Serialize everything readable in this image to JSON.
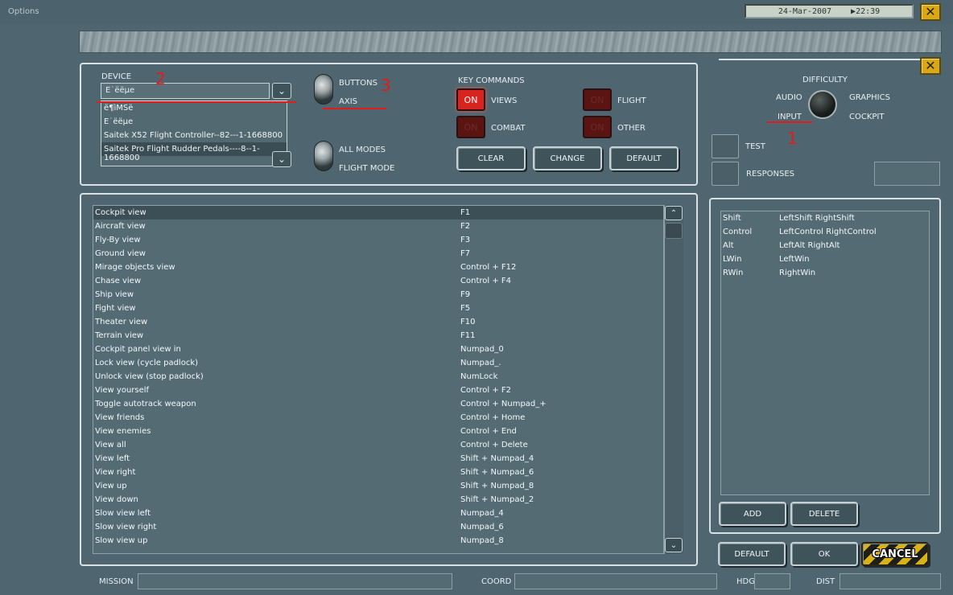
{
  "window": {
    "title": "Options",
    "date": "24-Mar-2007",
    "time": "22:39"
  },
  "device": {
    "label": "DEVICE",
    "selected": "E˙ëëµe",
    "options": [
      "ë¶ìMSë",
      "E˙ëëµe",
      "Saitek X52 Flight Controller--82---1-1668800",
      "Saitek Pro Flight Rudder Pedals----8--1-1668800"
    ]
  },
  "mode_toggle": {
    "buttons": "BUTTONS",
    "axis": "AXIS"
  },
  "mode_toggle2": {
    "all_modes": "ALL MODES",
    "flight_mode": "FLIGHT MODE"
  },
  "key_commands": {
    "title": "KEY COMMANDS",
    "views": {
      "led": "ON",
      "label": "VIEWS",
      "state": "on"
    },
    "combat": {
      "led": "ON",
      "label": "COMBAT",
      "state": "off"
    },
    "flight": {
      "led": "ON",
      "label": "FLIGHT",
      "state": "off"
    },
    "other": {
      "led": "ON",
      "label": "OTHER",
      "state": "off"
    },
    "clear": "CLEAR",
    "change": "CHANGE",
    "default": "DEFAULT"
  },
  "knob": {
    "difficulty": "DIFFICULTY",
    "audio": "AUDIO",
    "graphics": "GRAPHICS",
    "input": "INPUT",
    "cockpit": "COCKPIT"
  },
  "test": "TEST",
  "responses": "RESPONSES",
  "commands": [
    [
      "Cockpit view",
      "F1"
    ],
    [
      "Aircraft view",
      "F2"
    ],
    [
      "Fly-By view",
      "F3"
    ],
    [
      "Ground view",
      "F7"
    ],
    [
      "Mirage objects view",
      "Control + F12"
    ],
    [
      "Chase view",
      "Control + F4"
    ],
    [
      "Ship view",
      "F9"
    ],
    [
      "Fight view",
      "F5"
    ],
    [
      "Theater view",
      "F10"
    ],
    [
      "Terrain view",
      "F11"
    ],
    [
      "Cockpit panel view in",
      "Numpad_0"
    ],
    [
      "Lock view (cycle padlock)",
      "Numpad_."
    ],
    [
      "Unlock view (stop padlock)",
      "NumLock"
    ],
    [
      "View yourself",
      "Control + F2"
    ],
    [
      "Toggle autotrack weapon",
      "Control + Numpad_+"
    ],
    [
      "View friends",
      "Control + Home"
    ],
    [
      "View enemies",
      "Control + End"
    ],
    [
      "View all",
      "Control + Delete"
    ],
    [
      "View left",
      "Shift + Numpad_4"
    ],
    [
      "View right",
      "Shift + Numpad_6"
    ],
    [
      "View up",
      "Shift + Numpad_8"
    ],
    [
      "View down",
      "Shift + Numpad_2"
    ],
    [
      "Slow view left",
      "Numpad_4"
    ],
    [
      "Slow view right",
      "Numpad_6"
    ],
    [
      "Slow view up",
      "Numpad_8"
    ]
  ],
  "modifiers": [
    [
      "Shift",
      "LeftShift RightShift"
    ],
    [
      "Control",
      "LeftControl RightControl"
    ],
    [
      "Alt",
      "LeftAlt RightAlt"
    ],
    [
      "LWin",
      "LeftWin"
    ],
    [
      "RWin",
      "RightWin"
    ]
  ],
  "mod_buttons": {
    "add": "ADD",
    "delete": "DELETE"
  },
  "footer_buttons": {
    "default": "DEFAULT",
    "ok": "OK",
    "cancel": "CANCEL"
  },
  "status": {
    "mission": "MISSION",
    "coord": "COORD",
    "hdg": "HDG",
    "dist": "DIST"
  },
  "annotations": {
    "a1": "1",
    "a2": "2",
    "a3": "3"
  },
  "colors": {
    "background": "#4f6670",
    "led_on": "#d8241f",
    "led_off": "#5a1512",
    "annotation": "#e21b1b",
    "close": "#d9a814"
  }
}
